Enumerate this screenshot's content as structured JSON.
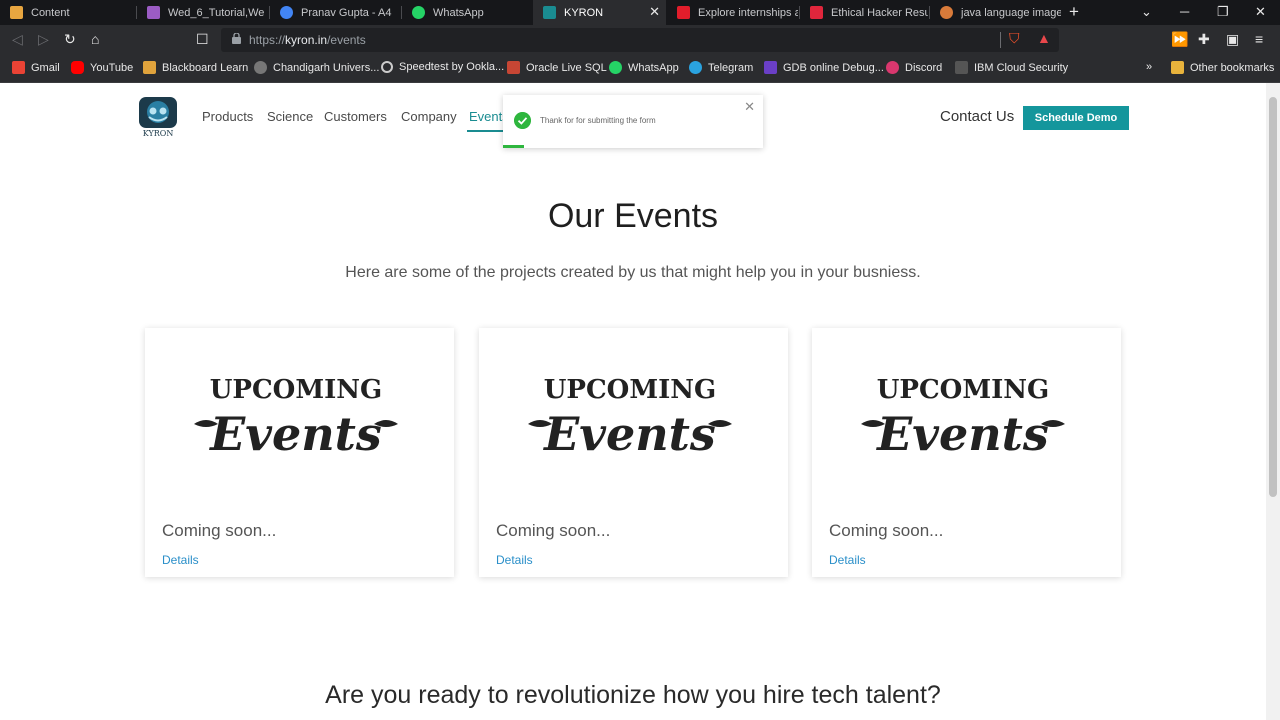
{
  "browser": {
    "tabs": [
      {
        "label": "Content",
        "color": "#e8a640"
      },
      {
        "label": "Wed_6_Tutorial,We",
        "color": "#9b5cc4"
      },
      {
        "label": "Pranav Gupta - A4",
        "color": "#4285f4"
      },
      {
        "label": "WhatsApp",
        "color": "#25d366"
      },
      {
        "label": "KYRON",
        "color": "#1a8c91"
      },
      {
        "label": "Explore internships at A",
        "color": "#e11d2b"
      },
      {
        "label": "Ethical Hacker Resume",
        "color": "#e0263c"
      },
      {
        "label": "java language images a",
        "color": "#d97b3a"
      }
    ],
    "url_scheme": "https://",
    "url_host": "kyron.in",
    "url_path": "/events",
    "bookmarks": [
      {
        "label": "Gmail",
        "color": "#ea4335"
      },
      {
        "label": "YouTube",
        "color": "#ff0000"
      },
      {
        "label": "Blackboard Learn",
        "color": "#e0a33c"
      },
      {
        "label": "Chandigarh Univers...",
        "color": "#888"
      },
      {
        "label": "Speedtest by Ookla...",
        "color": "#222"
      },
      {
        "label": "Oracle Live SQL",
        "color": "#c74634"
      },
      {
        "label": "WhatsApp",
        "color": "#25d366"
      },
      {
        "label": "Telegram",
        "color": "#2aa3e0"
      },
      {
        "label": "GDB online Debug...",
        "color": "#6a3fc6"
      },
      {
        "label": "Discord",
        "color": "#d9376e"
      },
      {
        "label": "IBM Cloud Security",
        "color": "#555"
      }
    ],
    "more_bookmarks": "»",
    "other_bookmarks": "Other bookmarks"
  },
  "site": {
    "logo_text": "KYRON",
    "nav": [
      "Products",
      "Science",
      "Customers",
      "Company",
      "Events"
    ],
    "contact": "Contact Us",
    "demo": "Schedule Demo",
    "accent": "#14969c"
  },
  "toast": {
    "message": "Thank for for submitting the form"
  },
  "main": {
    "heading": "Our Events",
    "subheading": "Here are some of the projects created by us that might help you in your busniess.",
    "cards": [
      {
        "image_top": "UPCOMING",
        "image_bottom": "Events",
        "title": "Coming soon...",
        "link": "Details"
      },
      {
        "image_top": "UPCOMING",
        "image_bottom": "Events",
        "title": "Coming soon...",
        "link": "Details"
      },
      {
        "image_top": "UPCOMING",
        "image_bottom": "Events",
        "title": "Coming soon...",
        "link": "Details"
      }
    ],
    "bottom_heading": "Are you ready to revolutionize how you hire tech talent?"
  }
}
